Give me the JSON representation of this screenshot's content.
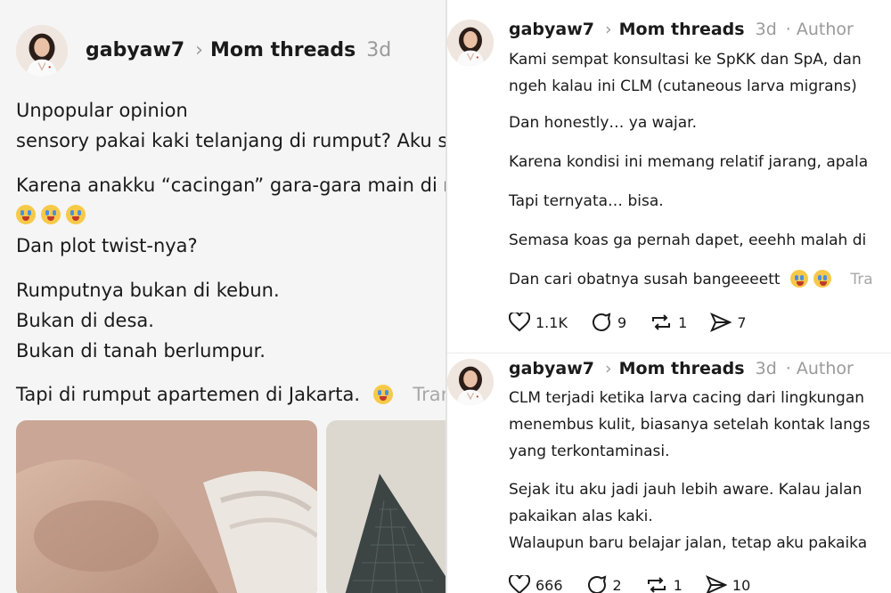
{
  "left_post": {
    "username": "gabyaw7",
    "community": "Mom threads",
    "age": "3d",
    "lines": [
      "Unpopular opinion",
      "sensory pakai kaki telanjang di rumput? Aku s",
      "Karena anakku “cacingan” gara-gara main di r",
      "Dan plot twist-nya?",
      "Rumputnya bukan di kebun.",
      "Bukan di desa.",
      "Bukan di tanah berlumpur.",
      "Tapi di rumput apartemen di Jakarta."
    ],
    "translate_label": "Trar",
    "emoji": [
      "crying-face",
      "crying-face",
      "crying-face",
      "crying-face"
    ],
    "images": [
      "child-leg-photo",
      "grid-mat-photo"
    ]
  },
  "right_post_1": {
    "username": "gabyaw7",
    "community": "Mom threads",
    "age": "3d",
    "role": "· Author",
    "lines": [
      "Kami sempat konsultasi ke SpKK dan SpA, dan",
      "ngeh kalau ini CLM (cutaneous larva migrans)",
      "Dan honestly… ya wajar.",
      "Karena kondisi ini memang relatif jarang, apala",
      "Tapi ternyata… bisa.",
      "Semasa koas ga pernah dapet, eeehh malah di",
      "Dan cari obatnya susah bangeeeett"
    ],
    "translate_label": "Tra",
    "emoji": [
      "crying-face",
      "crying-face"
    ],
    "actions": {
      "likes": "1.1K",
      "replies": "9",
      "reposts": "1",
      "shares": "7"
    }
  },
  "right_post_2": {
    "username": "gabyaw7",
    "community": "Mom threads",
    "age": "3d",
    "role": "· Author",
    "lines": [
      "CLM terjadi ketika larva cacing dari lingkungan",
      "menembus kulit, biasanya setelah kontak langs",
      "yang terkontaminasi.",
      "Sejak itu aku jadi jauh lebih aware. Kalau jalan",
      "pakaikan alas kaki.",
      "Walaupun baru belajar jalan, tetap aku pakaika"
    ],
    "actions": {
      "likes": "666",
      "replies": "2",
      "reposts": "1",
      "shares": "10"
    }
  },
  "colors": {
    "text": "#1a1a1a",
    "muted": "#9a9a9a",
    "left_bg": "#f5f5f5",
    "right_bg": "#ffffff"
  }
}
